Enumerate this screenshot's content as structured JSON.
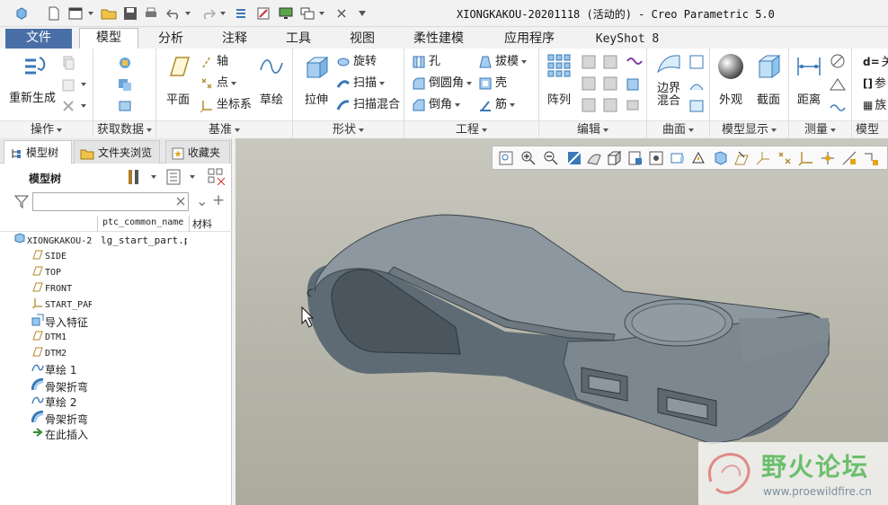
{
  "window": {
    "title": "XIONGKAKOU-20201118 (活动的) - Creo Parametric 5.0"
  },
  "tabs": [
    {
      "label": "文件"
    },
    {
      "label": "模型"
    },
    {
      "label": "分析"
    },
    {
      "label": "注释"
    },
    {
      "label": "工具"
    },
    {
      "label": "视图"
    },
    {
      "label": "柔性建模"
    },
    {
      "label": "应用程序"
    },
    {
      "label": "KeyShot 8"
    }
  ],
  "ribbon": {
    "operations": {
      "label": "操作",
      "regen": "重新生成"
    },
    "getdata": {
      "label": "获取数据"
    },
    "datum": {
      "label": "基准",
      "plane": "平面",
      "axis": "轴",
      "point": "点",
      "csys": "坐标系",
      "sketch": "草绘"
    },
    "shape": {
      "label": "形状",
      "extrude": "拉伸",
      "revolve": "旋转",
      "sweep": "扫描",
      "swept_blend": "扫描混合"
    },
    "engineering": {
      "label": "工程",
      "hole": "孔",
      "round": "倒圆角",
      "chamfer": "倒角",
      "draft": "拔模",
      "shell": "壳",
      "rib": "筋"
    },
    "edit": {
      "label": "编辑",
      "pattern": "阵列"
    },
    "surfaces": {
      "label": "曲面",
      "boundary_blend": "边界混合"
    },
    "display": {
      "label": "模型显示",
      "appearance": "外观",
      "section": "截面"
    },
    "measure": {
      "label": "测量",
      "distance": "距离"
    },
    "intent": {
      "label": "模型意",
      "r1": "关",
      "r2": "参",
      "r3": "族"
    }
  },
  "panel": {
    "tabs": [
      {
        "label": "模型树"
      },
      {
        "label": "文件夹浏览"
      },
      {
        "label": "收藏夹"
      }
    ],
    "tree_title": "模型树",
    "columns": {
      "c1": "ptc_common_name",
      "c2": "材料"
    },
    "root": {
      "name": "XIONGKAKOU-2",
      "common_name": "lg_start_part.pr"
    },
    "items": [
      {
        "label": "SIDE",
        "icon": "datum-plane-icon"
      },
      {
        "label": "TOP",
        "icon": "datum-plane-icon"
      },
      {
        "label": "FRONT",
        "icon": "datum-plane-icon"
      },
      {
        "label": "START_PAR",
        "icon": "csys-icon"
      },
      {
        "label": "导入特征",
        "icon": "import-icon"
      },
      {
        "label": "DTM1",
        "icon": "datum-plane-icon"
      },
      {
        "label": "DTM2",
        "icon": "datum-plane-icon"
      },
      {
        "label": "草绘 1",
        "icon": "sketch-icon"
      },
      {
        "label": "骨架折弯",
        "icon": "spinal-bend-icon"
      },
      {
        "label": "草绘 2",
        "icon": "sketch-icon"
      },
      {
        "label": "骨架折弯",
        "icon": "spinal-bend-icon"
      },
      {
        "label": "在此插入",
        "icon": "insert-here-icon"
      }
    ]
  },
  "watermark": {
    "name": "野火论坛",
    "url": "www.proewildfire.cn"
  },
  "colors": {
    "file_tab": "#4a6fa6",
    "model": "#7d8a94",
    "viewport_top": "#c9c8bf",
    "viewport_bottom": "#acab9e"
  }
}
